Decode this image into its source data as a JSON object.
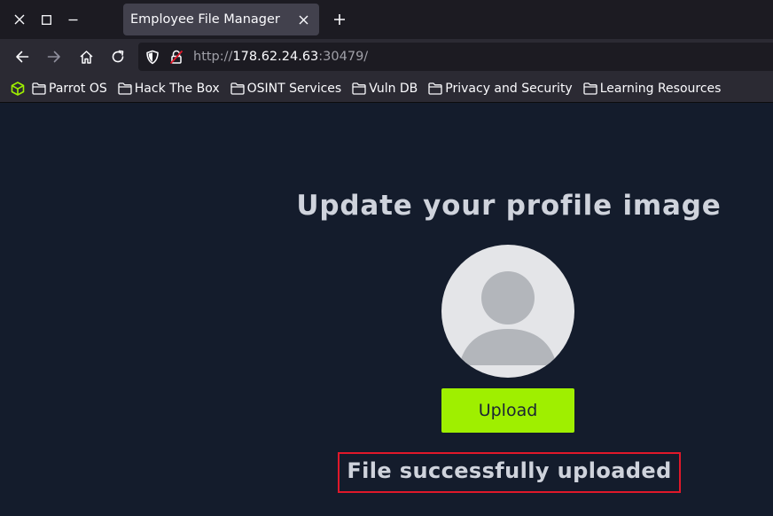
{
  "browser": {
    "tab": {
      "title": "Employee File Manager"
    },
    "url": {
      "scheme": "http://",
      "host": "178.62.24.63",
      "rest": ":30479/"
    },
    "bookmarks": [
      {
        "label": "Parrot OS"
      },
      {
        "label": "Hack The Box"
      },
      {
        "label": "OSINT Services"
      },
      {
        "label": "Vuln DB"
      },
      {
        "label": "Privacy and Security"
      },
      {
        "label": "Learning Resources"
      }
    ]
  },
  "page": {
    "title": "Update your profile image",
    "upload_label": "Upload",
    "status_message": "File successfully uploaded"
  },
  "colors": {
    "accent": "#9fef00",
    "page_background": "#141c2c",
    "status_border": "#e0182a"
  },
  "icons": {
    "window": [
      "close-icon",
      "restore-icon",
      "minimize-icon"
    ],
    "nav": [
      "back-arrow-icon",
      "forward-arrow-icon",
      "home-icon",
      "reload-icon"
    ],
    "url": [
      "shield-icon",
      "insecure-lock-icon"
    ],
    "bookmark": "folder-icon",
    "avatar": "user-silhouette-icon"
  }
}
